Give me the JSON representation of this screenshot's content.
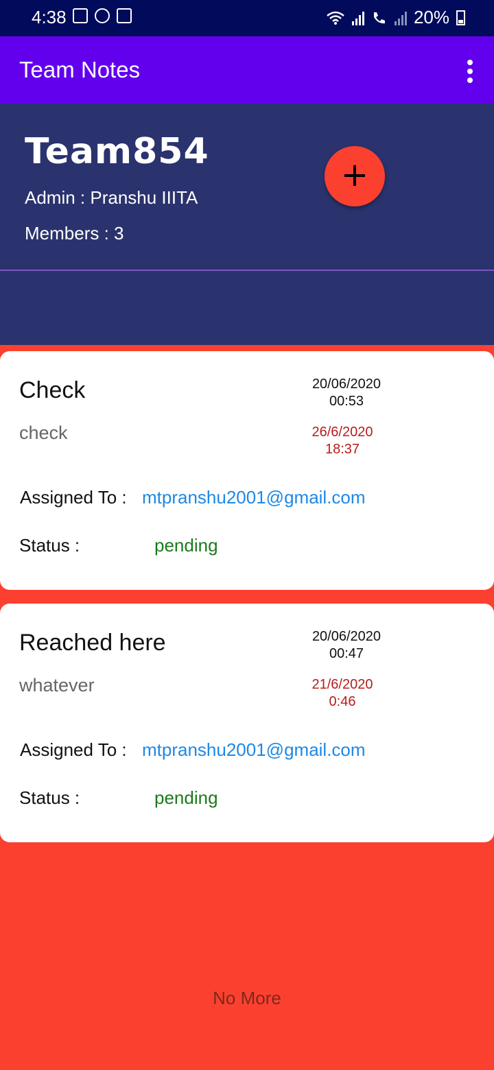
{
  "status_bar": {
    "time": "4:38",
    "battery": "20%",
    "icons": [
      "gallery-icon",
      "whatsapp-icon",
      "gmail-icon",
      "wifi-icon",
      "signal-icon",
      "volte-call-icon",
      "signal-2-icon",
      "battery-icon"
    ]
  },
  "app_bar": {
    "title": "Team Notes",
    "menu_icon": "more-vert-icon"
  },
  "team": {
    "name": "Team854",
    "admin": "Admin : Pranshu IIITA",
    "members": "Members : 3",
    "add_button_label": "+"
  },
  "notes": [
    {
      "title": "Check",
      "description": "check",
      "created_date": "20/06/2020",
      "created_time": "00:53",
      "due_date": "26/6/2020",
      "due_time": "18:37",
      "assigned_label": "Assigned To :",
      "assigned_to": "mtpranshu2001@gmail.com",
      "status_label": "Status :",
      "status": "pending"
    },
    {
      "title": "Reached here",
      "description": "whatever",
      "created_date": "20/06/2020",
      "created_time": "00:47",
      "due_date": "21/6/2020",
      "due_time": "0:46",
      "assigned_label": "Assigned To :",
      "assigned_to": "mtpranshu2001@gmail.com",
      "status_label": "Status :",
      "status": "pending"
    }
  ],
  "footer": {
    "no_more": "No More"
  },
  "colors": {
    "status_bar": "#020b5b",
    "app_bar": "#6200ee",
    "header": "#2a336e",
    "background": "#fc4030",
    "fab": "#fc4030",
    "link": "#1e88e5",
    "pending": "#1b7a1b",
    "due": "#b71c1c"
  }
}
